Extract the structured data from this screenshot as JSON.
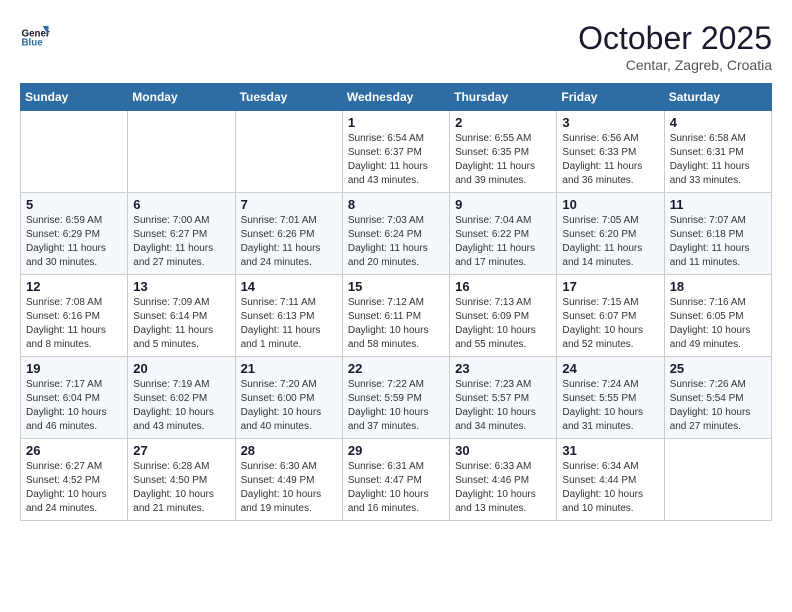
{
  "logo": {
    "line1": "General",
    "line2": "Blue"
  },
  "title": "October 2025",
  "subtitle": "Centar, Zagreb, Croatia",
  "headers": [
    "Sunday",
    "Monday",
    "Tuesday",
    "Wednesday",
    "Thursday",
    "Friday",
    "Saturday"
  ],
  "weeks": [
    [
      {
        "day": "",
        "info": ""
      },
      {
        "day": "",
        "info": ""
      },
      {
        "day": "",
        "info": ""
      },
      {
        "day": "1",
        "info": "Sunrise: 6:54 AM\nSunset: 6:37 PM\nDaylight: 11 hours and 43 minutes."
      },
      {
        "day": "2",
        "info": "Sunrise: 6:55 AM\nSunset: 6:35 PM\nDaylight: 11 hours and 39 minutes."
      },
      {
        "day": "3",
        "info": "Sunrise: 6:56 AM\nSunset: 6:33 PM\nDaylight: 11 hours and 36 minutes."
      },
      {
        "day": "4",
        "info": "Sunrise: 6:58 AM\nSunset: 6:31 PM\nDaylight: 11 hours and 33 minutes."
      }
    ],
    [
      {
        "day": "5",
        "info": "Sunrise: 6:59 AM\nSunset: 6:29 PM\nDaylight: 11 hours and 30 minutes."
      },
      {
        "day": "6",
        "info": "Sunrise: 7:00 AM\nSunset: 6:27 PM\nDaylight: 11 hours and 27 minutes."
      },
      {
        "day": "7",
        "info": "Sunrise: 7:01 AM\nSunset: 6:26 PM\nDaylight: 11 hours and 24 minutes."
      },
      {
        "day": "8",
        "info": "Sunrise: 7:03 AM\nSunset: 6:24 PM\nDaylight: 11 hours and 20 minutes."
      },
      {
        "day": "9",
        "info": "Sunrise: 7:04 AM\nSunset: 6:22 PM\nDaylight: 11 hours and 17 minutes."
      },
      {
        "day": "10",
        "info": "Sunrise: 7:05 AM\nSunset: 6:20 PM\nDaylight: 11 hours and 14 minutes."
      },
      {
        "day": "11",
        "info": "Sunrise: 7:07 AM\nSunset: 6:18 PM\nDaylight: 11 hours and 11 minutes."
      }
    ],
    [
      {
        "day": "12",
        "info": "Sunrise: 7:08 AM\nSunset: 6:16 PM\nDaylight: 11 hours and 8 minutes."
      },
      {
        "day": "13",
        "info": "Sunrise: 7:09 AM\nSunset: 6:14 PM\nDaylight: 11 hours and 5 minutes."
      },
      {
        "day": "14",
        "info": "Sunrise: 7:11 AM\nSunset: 6:13 PM\nDaylight: 11 hours and 1 minute."
      },
      {
        "day": "15",
        "info": "Sunrise: 7:12 AM\nSunset: 6:11 PM\nDaylight: 10 hours and 58 minutes."
      },
      {
        "day": "16",
        "info": "Sunrise: 7:13 AM\nSunset: 6:09 PM\nDaylight: 10 hours and 55 minutes."
      },
      {
        "day": "17",
        "info": "Sunrise: 7:15 AM\nSunset: 6:07 PM\nDaylight: 10 hours and 52 minutes."
      },
      {
        "day": "18",
        "info": "Sunrise: 7:16 AM\nSunset: 6:05 PM\nDaylight: 10 hours and 49 minutes."
      }
    ],
    [
      {
        "day": "19",
        "info": "Sunrise: 7:17 AM\nSunset: 6:04 PM\nDaylight: 10 hours and 46 minutes."
      },
      {
        "day": "20",
        "info": "Sunrise: 7:19 AM\nSunset: 6:02 PM\nDaylight: 10 hours and 43 minutes."
      },
      {
        "day": "21",
        "info": "Sunrise: 7:20 AM\nSunset: 6:00 PM\nDaylight: 10 hours and 40 minutes."
      },
      {
        "day": "22",
        "info": "Sunrise: 7:22 AM\nSunset: 5:59 PM\nDaylight: 10 hours and 37 minutes."
      },
      {
        "day": "23",
        "info": "Sunrise: 7:23 AM\nSunset: 5:57 PM\nDaylight: 10 hours and 34 minutes."
      },
      {
        "day": "24",
        "info": "Sunrise: 7:24 AM\nSunset: 5:55 PM\nDaylight: 10 hours and 31 minutes."
      },
      {
        "day": "25",
        "info": "Sunrise: 7:26 AM\nSunset: 5:54 PM\nDaylight: 10 hours and 27 minutes."
      }
    ],
    [
      {
        "day": "26",
        "info": "Sunrise: 6:27 AM\nSunset: 4:52 PM\nDaylight: 10 hours and 24 minutes."
      },
      {
        "day": "27",
        "info": "Sunrise: 6:28 AM\nSunset: 4:50 PM\nDaylight: 10 hours and 21 minutes."
      },
      {
        "day": "28",
        "info": "Sunrise: 6:30 AM\nSunset: 4:49 PM\nDaylight: 10 hours and 19 minutes."
      },
      {
        "day": "29",
        "info": "Sunrise: 6:31 AM\nSunset: 4:47 PM\nDaylight: 10 hours and 16 minutes."
      },
      {
        "day": "30",
        "info": "Sunrise: 6:33 AM\nSunset: 4:46 PM\nDaylight: 10 hours and 13 minutes."
      },
      {
        "day": "31",
        "info": "Sunrise: 6:34 AM\nSunset: 4:44 PM\nDaylight: 10 hours and 10 minutes."
      },
      {
        "day": "",
        "info": ""
      }
    ]
  ]
}
